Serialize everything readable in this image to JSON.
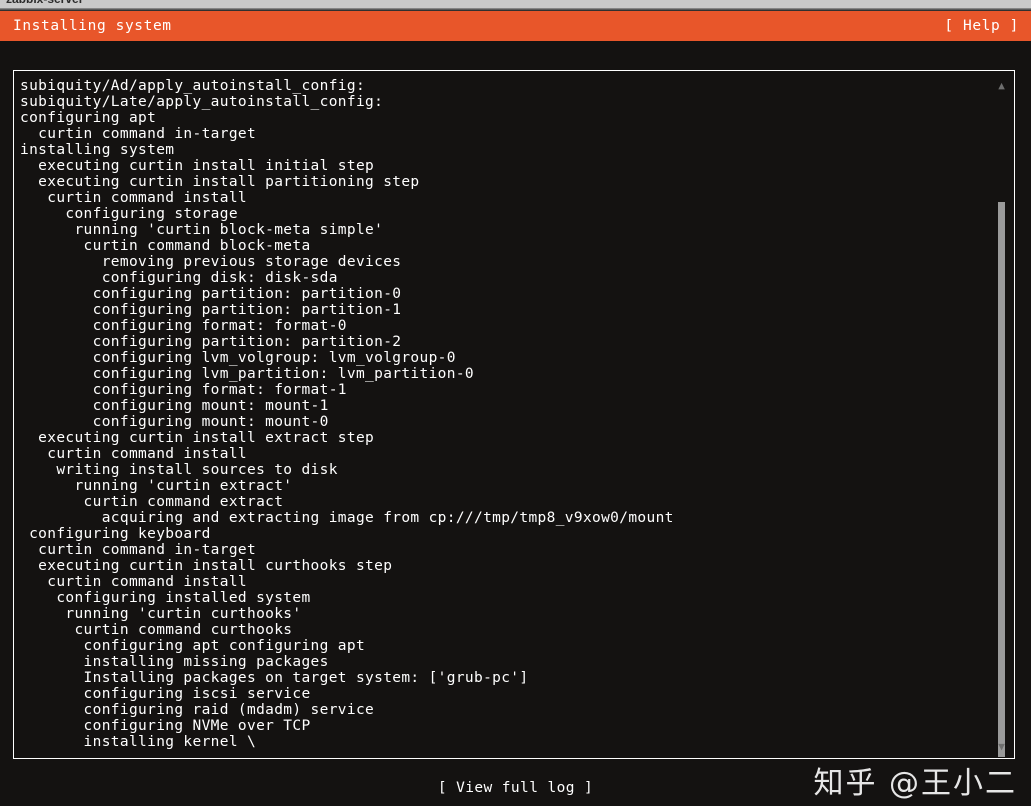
{
  "window": {
    "title": "zabbix-server"
  },
  "header": {
    "title": "Installing system",
    "help_label": "[ Help ]",
    "accent_color": "#e8562a",
    "text_color": "#ffffff"
  },
  "log": {
    "lines": [
      "subiquity/Ad/apply_autoinstall_config:",
      "subiquity/Late/apply_autoinstall_config:",
      "configuring apt",
      "  curtin command in-target",
      "installing system",
      "  executing curtin install initial step",
      "  executing curtin install partitioning step",
      "   curtin command install",
      "     configuring storage",
      "      running 'curtin block-meta simple'",
      "       curtin command block-meta",
      "         removing previous storage devices",
      "         configuring disk: disk-sda",
      "        configuring partition: partition-0",
      "        configuring partition: partition-1",
      "        configuring format: format-0",
      "        configuring partition: partition-2",
      "        configuring lvm_volgroup: lvm_volgroup-0",
      "        configuring lvm_partition: lvm_partition-0",
      "        configuring format: format-1",
      "        configuring mount: mount-1",
      "        configuring mount: mount-0",
      "  executing curtin install extract step",
      "   curtin command install",
      "    writing install sources to disk",
      "      running 'curtin extract'",
      "       curtin command extract",
      "         acquiring and extracting image from cp:///tmp/tmp8_v9xow0/mount",
      " configuring keyboard",
      "  curtin command in-target",
      "  executing curtin install curthooks step",
      "   curtin command install",
      "    configuring installed system",
      "     running 'curtin curthooks'",
      "      curtin command curthooks",
      "       configuring apt configuring apt",
      "       installing missing packages",
      "       Installing packages on target system: ['grub-pc']",
      "       configuring iscsi service",
      "       configuring raid (mdadm) service",
      "       configuring NVMe over TCP",
      "       installing kernel \\"
    ],
    "scrollbar": {
      "up_arrow": "▲",
      "down_arrow": "▼"
    }
  },
  "footer": {
    "view_full_log_label": "[ View full log ]"
  },
  "watermark": {
    "text": "知乎 @王小二"
  }
}
